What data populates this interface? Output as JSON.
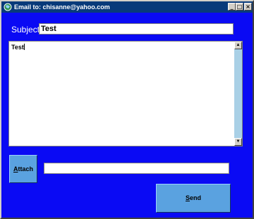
{
  "window": {
    "title": "Email to: chisanne@yahoo.com",
    "minimize_glyph": "_",
    "maximize_glyph": "□",
    "close_glyph": "×"
  },
  "form": {
    "subject_label": "Subject:",
    "subject_value": "Test",
    "body_value": "Test",
    "attachment_value": ""
  },
  "buttons": {
    "attach_label_mnemonic": "A",
    "attach_label_rest": "ttach",
    "send_label_mnemonic": "S",
    "send_label_rest": "end"
  },
  "icons": {
    "title_icon": "globe-icon",
    "scroll_up": "arrow-up-icon",
    "scroll_down": "arrow-down-icon"
  },
  "colors": {
    "background": "#0a0af4",
    "titlebar": "#083a7a",
    "button": "#5aa2e0",
    "scrollbar_track": "#a9d0e6"
  }
}
